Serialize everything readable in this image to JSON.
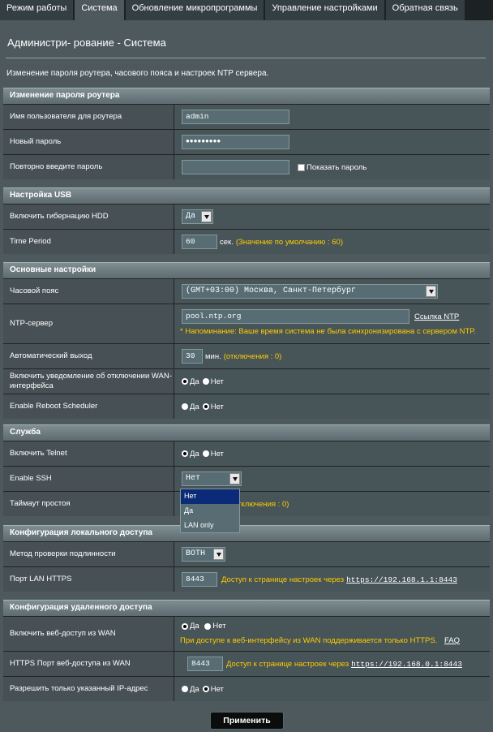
{
  "tabs": [
    "Режим работы",
    "Система",
    "Обновление микропрограммы",
    "Управление настройками",
    "Обратная связь"
  ],
  "page": {
    "title": "Администри- рование - Система",
    "description": "Изменение пароля роутера, часового пояса и настроек NTP сервера."
  },
  "sections": {
    "password": {
      "title": "Изменение пароля роутера",
      "username_label": "Имя пользователя для роутера",
      "username_value": "admin",
      "new_password_label": "Новый пароль",
      "new_password_value": "●●●●●●●●●",
      "repeat_password_label": "Повторно введите пароль",
      "repeat_password_value": "",
      "show_password_label": "Показать пароль"
    },
    "usb": {
      "title": "Настройка USB",
      "hibernate_label": "Включить гибернацию HDD",
      "hibernate_value": "Да",
      "time_period_label": "Time Period",
      "time_period_value": "60",
      "time_period_unit": "сек.",
      "time_period_hint": "(Значение по умолчанию : 60)"
    },
    "basic": {
      "title": "Основные настройки",
      "timezone_label": "Часовой пояс",
      "timezone_value": "(GMT+03:00) Москва, Санкт-Петербург",
      "ntp_label": "NTP-сервер",
      "ntp_value": "pool.ntp.org",
      "ntp_link": "Ссылка NTP",
      "ntp_warning": "* Напоминание: Ваше время система не была синхронизирована с сервером NTP.",
      "autologout_label": "Автоматический выход",
      "autologout_value": "30",
      "autologout_unit": "мин.",
      "autologout_hint": "(отключения : 0)",
      "wan_notify_label": "Включить уведомление об отключении WAN-интерфейса",
      "reboot_label": "Enable Reboot Scheduler"
    },
    "service": {
      "title": "Служба",
      "telnet_label": "Включить Telnet",
      "ssh_label": "Enable SSH",
      "ssh_value": "Нет",
      "idle_label": "Таймаут простоя",
      "idle_hint": "отключения : 0)",
      "ssh_options": [
        "Нет",
        "Да",
        "LAN only"
      ]
    },
    "local": {
      "title": "Конфигурация локального доступа",
      "auth_label": "Метод проверки подлинности",
      "auth_value": "BOTH",
      "https_port_label": "Порт LAN HTTPS",
      "https_port_value": "8443",
      "https_hint": "Доступ к странице настроек через",
      "https_link": "https://192.168.1.1:8443"
    },
    "remote": {
      "title": "Конфигурация удаленного доступа",
      "wan_access_label": "Включить веб-доступ из WAN",
      "wan_note": "При доступе к веб-интерфейсу из WAN поддерживается только HTTPS.",
      "faq": "FAQ",
      "wan_port_label": "HTTPS Порт веб-доступа из WAN",
      "wan_port_value": "8443",
      "wan_hint": "Доступ к странице настроек через",
      "wan_link": "https://192.168.0.1:8443",
      "ip_only_label": "Разрешить только указанный IP-адрес"
    }
  },
  "radio": {
    "yes": "Да",
    "no": "Нет"
  },
  "apply_label": "Применить"
}
